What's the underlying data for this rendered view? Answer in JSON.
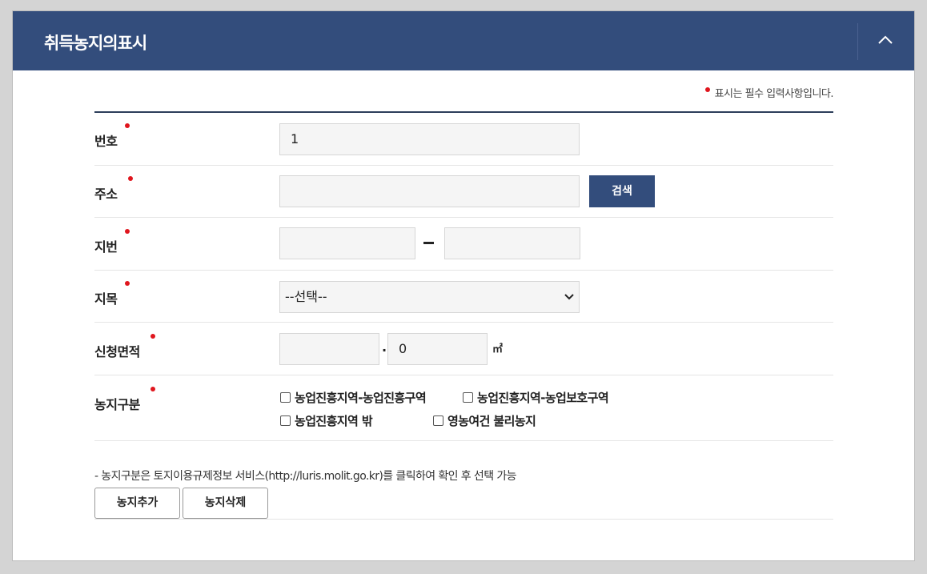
{
  "header": {
    "title": "취득농지의표시"
  },
  "required_note": "표시는 필수 입력사항입니다.",
  "form": {
    "number": {
      "label": "번호",
      "value": "1"
    },
    "address": {
      "label": "주소",
      "value": "",
      "search_label": "검색"
    },
    "lot": {
      "label": "지번",
      "main_value": "",
      "sub_value": ""
    },
    "land_category": {
      "label": "지목",
      "selected": "--선택--"
    },
    "area": {
      "label": "신청면적",
      "integer_value": "",
      "decimal_sep": ".",
      "decimal_value": "0",
      "unit": "㎡"
    },
    "farm_type": {
      "label": "농지구분",
      "options": [
        "농업진흥지역-농업진흥구역",
        "농업진흥지역-농업보호구역",
        "농업진흥지역 밖",
        "영농여건 불리농지"
      ]
    }
  },
  "notice": "- 농지구분은 토지이용규제정보 서비스(http://luris.molit.go.kr)를 클릭하여 확인 후 선택 가능",
  "buttons": {
    "add": "농지추가",
    "delete": "농지삭제"
  },
  "colors": {
    "header_bg": "#334d7c",
    "required_dot": "#e0161e"
  }
}
